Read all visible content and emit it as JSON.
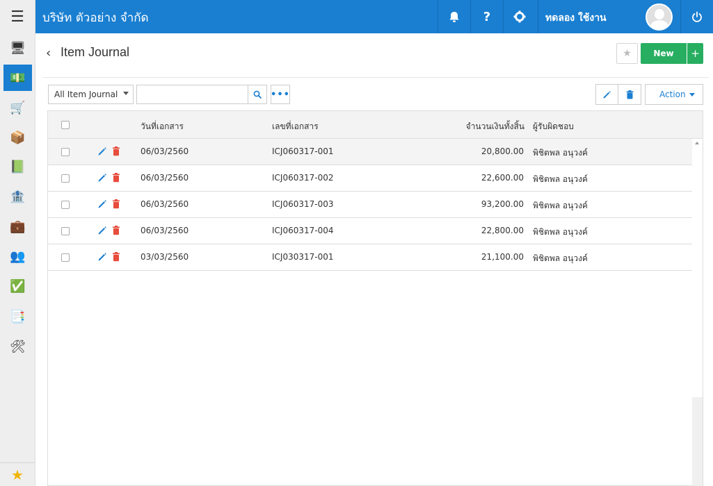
{
  "topbar": {
    "company": "บริษัท ตัวอย่าง จำกัด",
    "notifications_icon": "bell-icon",
    "help_label": "?",
    "settings_icon": "gear-icon",
    "username": "ทดลอง ใช้งาน",
    "power_icon": "power-icon"
  },
  "rail": {
    "items": [
      {
        "name": "dashboard-icon",
        "glyph": "🖥"
      },
      {
        "name": "money-icon",
        "glyph": "💵"
      },
      {
        "name": "cart-icon",
        "glyph": "🛒"
      },
      {
        "name": "box-icon",
        "glyph": "📦"
      },
      {
        "name": "book-icon",
        "glyph": "📗"
      },
      {
        "name": "bank-icon",
        "glyph": "🏦"
      },
      {
        "name": "wallet-icon",
        "glyph": "💼"
      },
      {
        "name": "people-icon",
        "glyph": "👥"
      },
      {
        "name": "check-icon",
        "glyph": "✅"
      },
      {
        "name": "transfer-icon",
        "glyph": "📑"
      },
      {
        "name": "tools-icon",
        "glyph": "🛠"
      }
    ],
    "favorite_glyph": "★"
  },
  "page": {
    "back_glyph": "‹",
    "title": "Item Journal",
    "new_label": "New",
    "plus_label": "+",
    "star_glyph": "★"
  },
  "toolbar": {
    "filter_value": "All Item Journal",
    "search_value": "",
    "more_label": "•••",
    "action_label": "Action"
  },
  "table": {
    "columns": [
      "วันที่เอกสาร",
      "เลขที่เอกสาร",
      "จำนวนเงินทั้งสิ้น",
      "ผู้รับผิดชอบ"
    ],
    "rows": [
      {
        "date": "06/03/2560",
        "doc_no": "ICJ060317-001",
        "amount": "20,800.00",
        "owner": "พิชิตพล อนุวงค์"
      },
      {
        "date": "06/03/2560",
        "doc_no": "ICJ060317-002",
        "amount": "22,600.00",
        "owner": "พิชิตพล อนุวงค์"
      },
      {
        "date": "06/03/2560",
        "doc_no": "ICJ060317-003",
        "amount": "93,200.00",
        "owner": "พิชิตพล อนุวงค์"
      },
      {
        "date": "06/03/2560",
        "doc_no": "ICJ060317-004",
        "amount": "22,800.00",
        "owner": "พิชิตพล อนุวงค์"
      },
      {
        "date": "03/03/2560",
        "doc_no": "ICJ030317-001",
        "amount": "21,100.00",
        "owner": "พิชิตพล อนุวงค์"
      }
    ]
  },
  "colors": {
    "primary": "#1a7fd1",
    "success": "#27ae60",
    "danger": "#e74c3c"
  }
}
